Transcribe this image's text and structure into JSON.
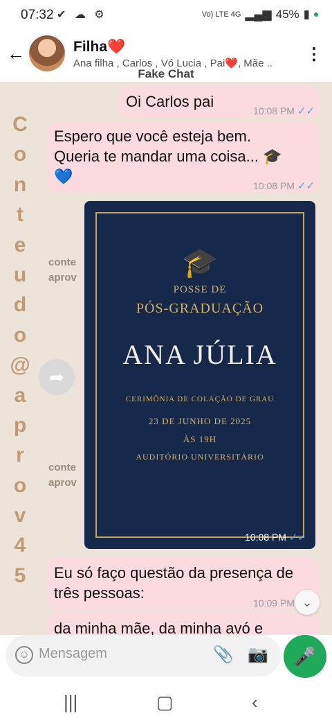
{
  "status": {
    "time": "07:32",
    "left_icons": "✔ ☁ ⚙",
    "network": "Vo) LTE 4G",
    "battery": "45%"
  },
  "header": {
    "back_icon": "arrow-left",
    "name": "Filha❤️",
    "participants": "Ana filha , Carlos , Vó Lucia , Pai❤️, Mãe ..",
    "menu_icon": "more-vert"
  },
  "banner": "Fake Chat",
  "watermark": {
    "vertical": [
      "C",
      "o",
      "n",
      "t",
      "e",
      "u",
      "d",
      "o",
      "@",
      "a",
      "p",
      "r",
      "o",
      "v",
      "4",
      "5"
    ],
    "small_top": [
      "conte",
      "aprov"
    ],
    "small_bottom": [
      "conte",
      "aprov"
    ]
  },
  "messages": [
    {
      "text": "Oi Carlos pai",
      "time": "10:08 PM"
    },
    {
      "text_line1": "Espero que você esteja bem.",
      "text_line2": "Queria te mandar uma coisa... 🎓",
      "text_line3": "💙",
      "time": "10:08 PM"
    },
    {
      "type": "image",
      "time": "10:08 PM"
    },
    {
      "text_line1": "Eu só faço questão da presença de",
      "text_line2": "três pessoas:",
      "time": "10:09 PM"
    },
    {
      "partial": "da minha mãe, da minha avó      e"
    }
  ],
  "invitation": {
    "line1": "POSSE DE",
    "line2": "PÓS-GRADUAÇÃO",
    "name": "ANA JÚLIA",
    "line3": "CERIMÔNIA DE COLAÇÃO DE GRAU",
    "date": "23 DE JUNHO DE 2025",
    "hour": "ÀS 19H",
    "place": "AUDITÓRIO UNIVERSITÁRIO"
  },
  "composer": {
    "placeholder": "Mensagem"
  },
  "colors": {
    "bubble": "#fbdbe0",
    "card": "#17294a",
    "gold": "#d4b169",
    "accent": "#1faa59"
  }
}
